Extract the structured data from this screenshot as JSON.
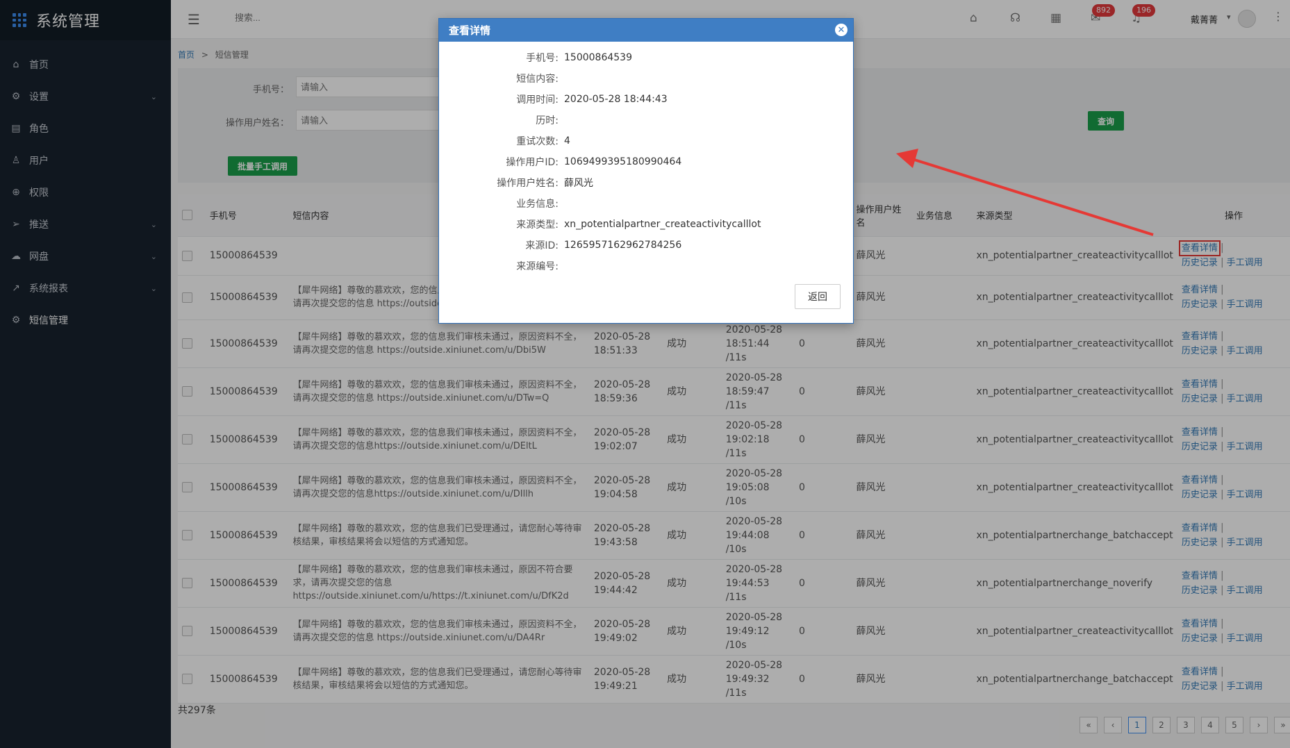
{
  "app": {
    "title": "系统管理"
  },
  "sidebar": {
    "items": [
      {
        "label": "首页",
        "icon": "home-icon",
        "glyph": "⌂",
        "chevron": false
      },
      {
        "label": "设置",
        "icon": "gear-icon",
        "glyph": "⚙",
        "chevron": true
      },
      {
        "label": "角色",
        "icon": "role-icon",
        "glyph": "▤",
        "chevron": false
      },
      {
        "label": "用户",
        "icon": "user-icon",
        "glyph": "♙",
        "chevron": false
      },
      {
        "label": "权限",
        "icon": "lock-icon",
        "glyph": "⊕",
        "chevron": false
      },
      {
        "label": "推送",
        "icon": "send-icon",
        "glyph": "➢",
        "chevron": true
      },
      {
        "label": "网盘",
        "icon": "cloud-icon",
        "glyph": "☁",
        "chevron": true
      },
      {
        "label": "系统报表",
        "icon": "chart-icon",
        "glyph": "↗",
        "chevron": true
      },
      {
        "label": "短信管理",
        "icon": "gear-icon",
        "glyph": "⚙",
        "chevron": false
      }
    ]
  },
  "topbar": {
    "search_placeholder": "搜索...",
    "badge_mail": "892",
    "badge_bell": "196",
    "user_name": "戴菁菁"
  },
  "breadcrumb": {
    "home": "首页",
    "separator": ">",
    "current": "短信管理"
  },
  "filter": {
    "phone_label": "手机号：",
    "phone_placeholder": "请输入",
    "operator_label": "操作用户姓名：",
    "operator_placeholder": "请输入",
    "query_button": "查询",
    "batch_button": "批量手工调用"
  },
  "table": {
    "headers": {
      "phone": "手机号",
      "content": "短信内容",
      "operator": "操作用户姓名",
      "business": "业务信息",
      "source_type": "来源类型",
      "actions": "操作"
    },
    "action_labels": {
      "view": "查看详情",
      "history": "历史记录",
      "manual": "手工调用"
    },
    "rows": [
      {
        "phone": "15000864539",
        "content": "",
        "call_time": "",
        "status": "",
        "done_time": "",
        "retry": "",
        "operator": "薛风光",
        "source_type": "xn_potentialpartner_createactivitycalllot"
      },
      {
        "phone": "15000864539",
        "content": "【犀牛网络】尊敬的慕欢欢，您的信息我们审核未通过，原因资料不全，请再次提交您的信息 https://outside.xiniunet.com/u/",
        "call_time": "",
        "status": "",
        "done_time": "",
        "retry": "",
        "operator": "薛风光",
        "source_type": "xn_potentialpartner_createactivitycalllot"
      },
      {
        "phone": "15000864539",
        "content": "【犀牛网络】尊敬的慕欢欢，您的信息我们审核未通过，原因资料不全，请再次提交您的信息 https://outside.xiniunet.com/u/Dbi5W",
        "call_time": "2020-05-28 18:51:33",
        "status": "成功",
        "done_time": "2020-05-28 18:51:44 /11s",
        "retry": "0",
        "operator": "薛风光",
        "source_type": "xn_potentialpartner_createactivitycalllot"
      },
      {
        "phone": "15000864539",
        "content": "【犀牛网络】尊敬的慕欢欢，您的信息我们审核未通过，原因资料不全，请再次提交您的信息 https://outside.xiniunet.com/u/DTw=Q",
        "call_time": "2020-05-28 18:59:36",
        "status": "成功",
        "done_time": "2020-05-28 18:59:47 /11s",
        "retry": "0",
        "operator": "薛风光",
        "source_type": "xn_potentialpartner_createactivitycalllot"
      },
      {
        "phone": "15000864539",
        "content": "【犀牛网络】尊敬的慕欢欢，您的信息我们审核未通过，原因资料不全，请再次提交您的信息https://outside.xiniunet.com/u/DEltL",
        "call_time": "2020-05-28 19:02:07",
        "status": "成功",
        "done_time": "2020-05-28 19:02:18 /11s",
        "retry": "0",
        "operator": "薛风光",
        "source_type": "xn_potentialpartner_createactivitycalllot"
      },
      {
        "phone": "15000864539",
        "content": "【犀牛网络】尊敬的慕欢欢，您的信息我们审核未通过，原因资料不全，请再次提交您的信息https://outside.xiniunet.com/u/DIllh",
        "call_time": "2020-05-28 19:04:58",
        "status": "成功",
        "done_time": "2020-05-28 19:05:08 /10s",
        "retry": "0",
        "operator": "薛风光",
        "source_type": "xn_potentialpartner_createactivitycalllot"
      },
      {
        "phone": "15000864539",
        "content": "【犀牛网络】尊敬的慕欢欢，您的信息我们已受理通过，请您耐心等待审核结果，审核结果将会以短信的方式通知您。",
        "call_time": "2020-05-28 19:43:58",
        "status": "成功",
        "done_time": "2020-05-28 19:44:08 /10s",
        "retry": "0",
        "operator": "薛风光",
        "source_type": "xn_potentialpartnerchange_batchaccept"
      },
      {
        "phone": "15000864539",
        "content": "【犀牛网络】尊敬的慕欢欢，您的信息我们审核未通过，原因不符合要求，请再次提交您的信息 https://outside.xiniunet.com/u/https://t.xiniunet.com/u/DfK2d",
        "call_time": "2020-05-28 19:44:42",
        "status": "成功",
        "done_time": "2020-05-28 19:44:53 /11s",
        "retry": "0",
        "operator": "薛风光",
        "source_type": "xn_potentialpartnerchange_noverify"
      },
      {
        "phone": "15000864539",
        "content": "【犀牛网络】尊敬的慕欢欢，您的信息我们审核未通过，原因资料不全，请再次提交您的信息 https://outside.xiniunet.com/u/DA4Rr",
        "call_time": "2020-05-28 19:49:02",
        "status": "成功",
        "done_time": "2020-05-28 19:49:12 /10s",
        "retry": "0",
        "operator": "薛风光",
        "source_type": "xn_potentialpartner_createactivitycalllot"
      },
      {
        "phone": "15000864539",
        "content": "【犀牛网络】尊敬的慕欢欢，您的信息我们已受理通过，请您耐心等待审核结果，审核结果将会以短信的方式通知您。",
        "call_time": "2020-05-28 19:49:21",
        "status": "成功",
        "done_time": "2020-05-28 19:49:32 /11s",
        "retry": "0",
        "operator": "薛风光",
        "source_type": "xn_potentialpartnerchange_batchaccept"
      }
    ]
  },
  "footer": {
    "total": "共297条",
    "pages": [
      "«",
      "‹",
      "1",
      "2",
      "3",
      "4",
      "5",
      "›",
      "»"
    ],
    "active_page": "1"
  },
  "modal": {
    "title": "查看详情",
    "back_button": "返回",
    "fields": [
      {
        "label": "手机号:",
        "value": "15000864539"
      },
      {
        "label": "短信内容:",
        "value": ""
      },
      {
        "label": "调用时间:",
        "value": "2020-05-28 18:44:43"
      },
      {
        "label": "历时:",
        "value": ""
      },
      {
        "label": "重试次数:",
        "value": "4"
      },
      {
        "label": "操作用户ID:",
        "value": "1069499395180990464"
      },
      {
        "label": "操作用户姓名:",
        "value": "薛风光"
      },
      {
        "label": "业务信息:",
        "value": ""
      },
      {
        "label": "来源类型:",
        "value": "xn_potentialpartner_createactivitycalllot"
      },
      {
        "label": "来源ID:",
        "value": "1265957162962784256"
      },
      {
        "label": "来源编号:",
        "value": ""
      }
    ]
  },
  "colors": {
    "sidebar_bg": "#18222e",
    "modal_header": "#3f7ec4",
    "green_button": "#1a9e4a",
    "link": "#337ab7",
    "annotation_red": "#e53935",
    "badge_red": "#e4393c"
  }
}
